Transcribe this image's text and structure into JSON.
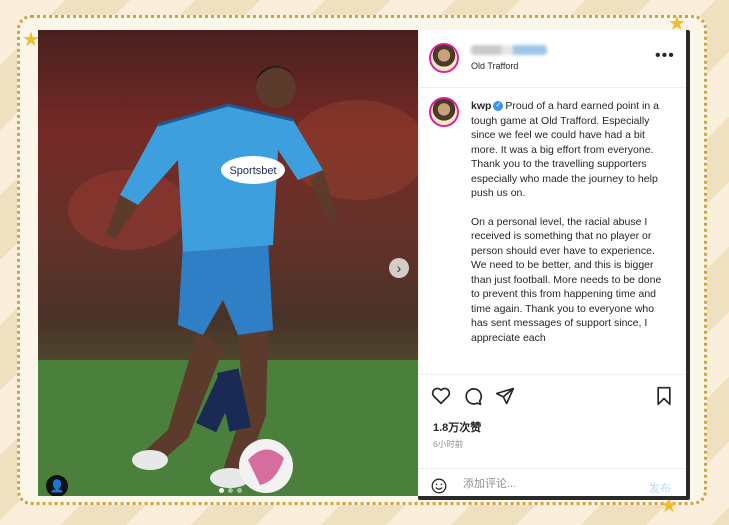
{
  "post": {
    "location": "Old Trafford",
    "caption_user": "kwp",
    "caption_p1": "Proud of a hard earned point in a tough game at Old Trafford. Especially since we feel we could have had a bit more. It was a big effort from everyone. Thank you to the travelling supporters especially who made the journey to help push us on.",
    "caption_p2": "On a personal level, the racial abuse I received is something that no player or person should ever have to experience. We need to be better, and this is bigger than just football. More needs to be done to prevent this from happening time and time again. Thank you to everyone who has sent messages of support since, I appreciate each",
    "likes": "1.8万次赞",
    "time": "6小时前",
    "comment_placeholder": "添加评论...",
    "post_label": "发布",
    "more_label": "•••",
    "carousel_next": "›"
  },
  "photo": {
    "sponsor": "Sportsbet"
  },
  "icons": [
    "heart-icon",
    "comment-icon",
    "share-icon",
    "bookmark-icon",
    "emoji-icon",
    "user-tag-icon",
    "verified-icon",
    "more-icon"
  ],
  "colors": {
    "frame_border": "#d4a13c",
    "star": "#f0bd2c",
    "verified": "#3897f0",
    "post_button": "#b2dffc"
  }
}
